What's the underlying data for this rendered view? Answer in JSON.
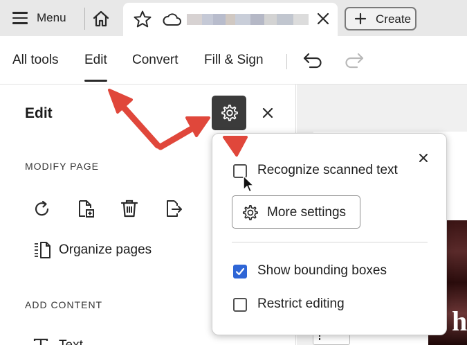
{
  "topbar": {
    "menu_label": "Menu",
    "create_label": "Create",
    "icons": {
      "menu": "hamburger-icon",
      "home": "home-icon",
      "star": "star-icon",
      "cloud": "cloud-icon",
      "close_tab": "close-icon",
      "create": "plus-icon"
    }
  },
  "toolbar": {
    "tabs": [
      "All tools",
      "Edit",
      "Convert",
      "Fill & Sign"
    ],
    "active_tab": "Edit",
    "icons": {
      "undo": "undo-icon",
      "redo": "redo-icon"
    }
  },
  "panel": {
    "title": "Edit",
    "modify_heading": "MODIFY PAGE",
    "page_tools": [
      "rotate-icon",
      "insert-page-icon",
      "delete-icon",
      "extract-icon"
    ],
    "organize_label": "Organize pages",
    "add_heading": "ADD CONTENT",
    "text_label": "Text"
  },
  "popup": {
    "recognize_label": "Recognize scanned text",
    "recognize_checked": false,
    "more_settings_label": "More settings",
    "show_bounding_label": "Show bounding boxes",
    "show_bounding_checked": true,
    "restrict_label": "Restrict editing",
    "restrict_checked": false
  },
  "doc": {
    "visible_glyph": "h"
  },
  "colors": {
    "accent": "#2f66d6",
    "annotation_arrow": "#e0473b",
    "gear_button": "#3b3b3b",
    "topbar_bg": "#e8e8e8"
  }
}
